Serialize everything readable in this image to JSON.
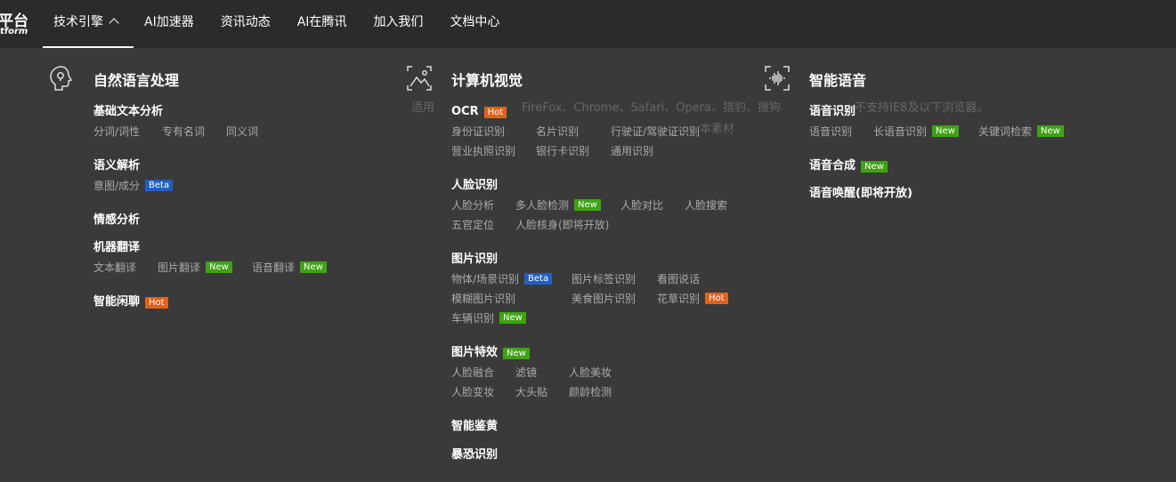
{
  "logo": {
    "main": "平台",
    "sub": "tform"
  },
  "nav": [
    {
      "label": "技术引擎"
    },
    {
      "label": "AI加速器"
    },
    {
      "label": "资讯动态"
    },
    {
      "label": "AI在腾讯"
    },
    {
      "label": "加入我们"
    },
    {
      "label": "文档中心"
    }
  ],
  "background_text": {
    "line1a": "适用",
    "line1b": "FireFox、Chrome、Safari、Opera、猎豹、搜狗",
    "line1c": "不支持IE8及以下浏览器。",
    "line2": "本素材"
  },
  "nlp": {
    "title": "自然语言处理",
    "basic": {
      "title": "基础文本分析",
      "items": [
        "分词/词性",
        "专有名词",
        "同义词"
      ]
    },
    "semantic": {
      "title": "语义解析",
      "items": [
        "意图/成分"
      ],
      "badge": "Beta"
    },
    "sentiment": {
      "title": "情感分析"
    },
    "translate": {
      "title": "机器翻译",
      "items": [
        "文本翻译",
        "图片翻译",
        "语音翻译"
      ],
      "badge": "New"
    },
    "chat": {
      "title": "智能闲聊",
      "badge": "Hot"
    }
  },
  "cv": {
    "title": "计算机视觉",
    "ocr": {
      "title": "OCR",
      "badge": "Hot",
      "items": [
        "身份证识别",
        "名片识别",
        "行驶证/驾驶证识别",
        "营业执照识别",
        "银行卡识别",
        "通用识别"
      ]
    },
    "face": {
      "title": "人脸识别",
      "items": [
        "人脸分析",
        "多人脸检测",
        "人脸对比",
        "人脸搜索",
        "五官定位",
        "人脸核身(即将开放)"
      ],
      "badge": "New"
    },
    "image": {
      "title": "图片识别",
      "items": [
        "物体/场景识别",
        "图片标签识别",
        "看图说话",
        "模糊图片识别",
        "美食图片识别",
        "花草识别",
        "车辆识别"
      ],
      "badge_beta": "Beta",
      "badge_hot": "Hot",
      "badge_new": "New"
    },
    "effect": {
      "title": "图片特效",
      "badge": "New",
      "items": [
        "人脸融合",
        "滤镜",
        "人脸美妆",
        "人脸变妆",
        "大头贴",
        "颜龄检测"
      ]
    },
    "porn": {
      "title": "智能鉴黄"
    },
    "terror": {
      "title": "暴恐识别"
    }
  },
  "voice": {
    "title": "智能语音",
    "asr": {
      "title": "语音识别",
      "items": [
        "语音识别",
        "长语音识别",
        "关键词检索"
      ],
      "badge": "New"
    },
    "tts": {
      "title": "语音合成",
      "badge": "New"
    },
    "wake": {
      "title": "语音唤醒(即将开放)"
    }
  }
}
